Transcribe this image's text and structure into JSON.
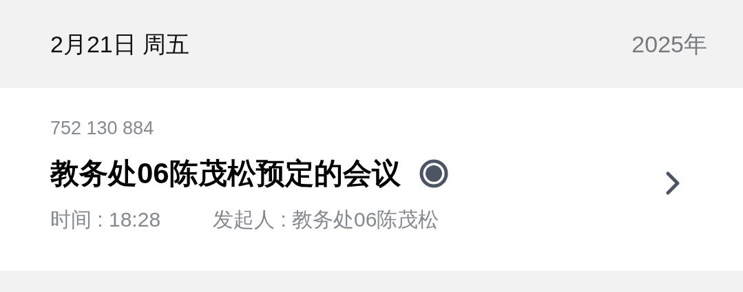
{
  "header": {
    "date": "2月21日 周五",
    "year": "2025年"
  },
  "meeting": {
    "number": "752 130 884",
    "title": "教务处06陈茂松预定的会议",
    "time": "时间 : 18:28",
    "organizer": "发起人 : 教务处06陈茂松"
  }
}
